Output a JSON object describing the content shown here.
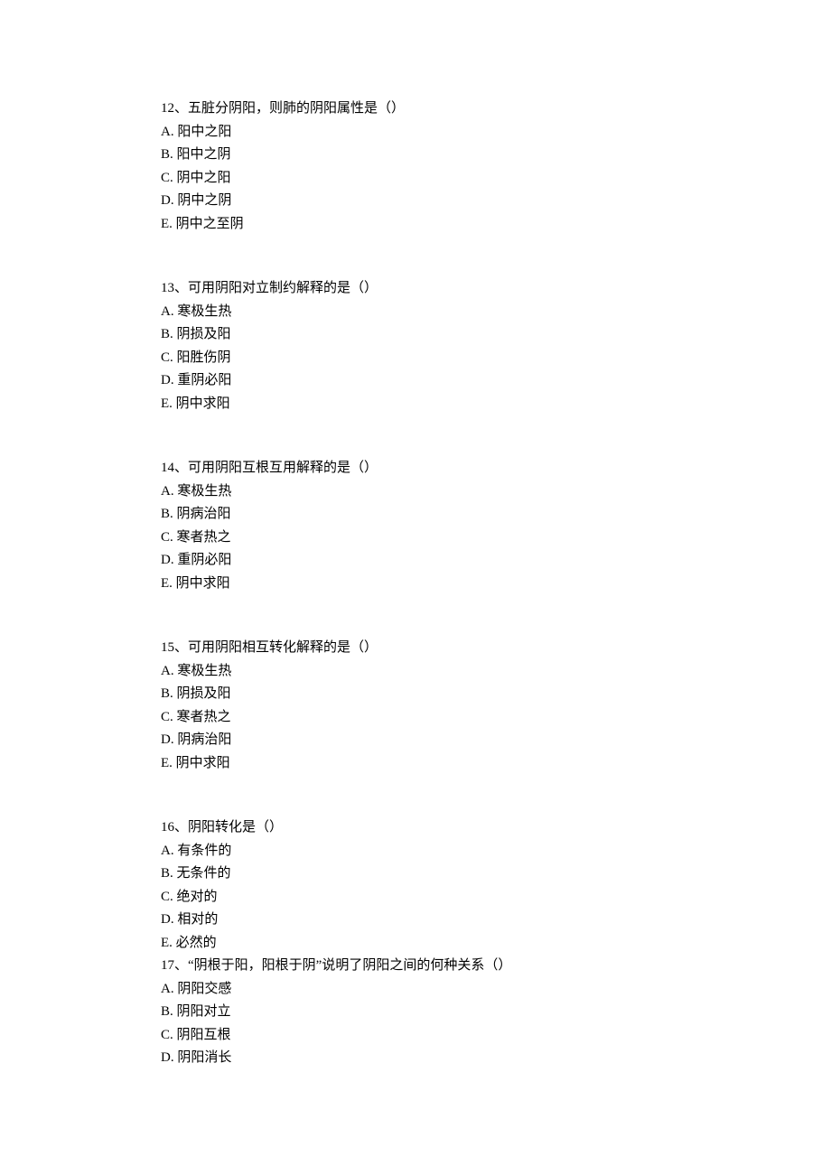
{
  "q12": {
    "stem": "12、五脏分阴阳，则肺的阴阳属性是（）",
    "A": "A. 阳中之阳",
    "B": "B. 阳中之阴",
    "C": "C. 阴中之阳",
    "D": "D. 阴中之阴",
    "E": "E. 阴中之至阴"
  },
  "q13": {
    "stem": "13、可用阴阳对立制约解释的是（）",
    "A": "A. 寒极生热",
    "B": "B. 阴损及阳",
    "C": "C. 阳胜伤阴",
    "D": "D. 重阴必阳",
    "E": "E. 阴中求阳"
  },
  "q14": {
    "stem": "14、可用阴阳互根互用解释的是（）",
    "A": "A. 寒极生热",
    "B": "B. 阴病治阳",
    "C": "C. 寒者热之",
    "D": "D. 重阴必阳",
    "E": "E. 阴中求阳"
  },
  "q15": {
    "stem": "15、可用阴阳相互转化解释的是（）",
    "A": "A. 寒极生热",
    "B": "B. 阴损及阳",
    "C": "C. 寒者热之",
    "D": "D. 阴病治阳",
    "E": "E. 阴中求阳"
  },
  "q16": {
    "stem": "16、阴阳转化是（）",
    "A": "A. 有条件的",
    "B": "B. 无条件的",
    "C": "C. 绝对的",
    "D": "D. 相对的",
    "E": "E. 必然的"
  },
  "q17": {
    "stem": "17、“阴根于阳，阳根于阴”说明了阴阳之间的何种关系（）",
    "A": "A. 阴阳交感",
    "B": "B. 阴阳对立",
    "C": "C. 阴阳互根",
    "D": "D. 阴阳消长"
  }
}
